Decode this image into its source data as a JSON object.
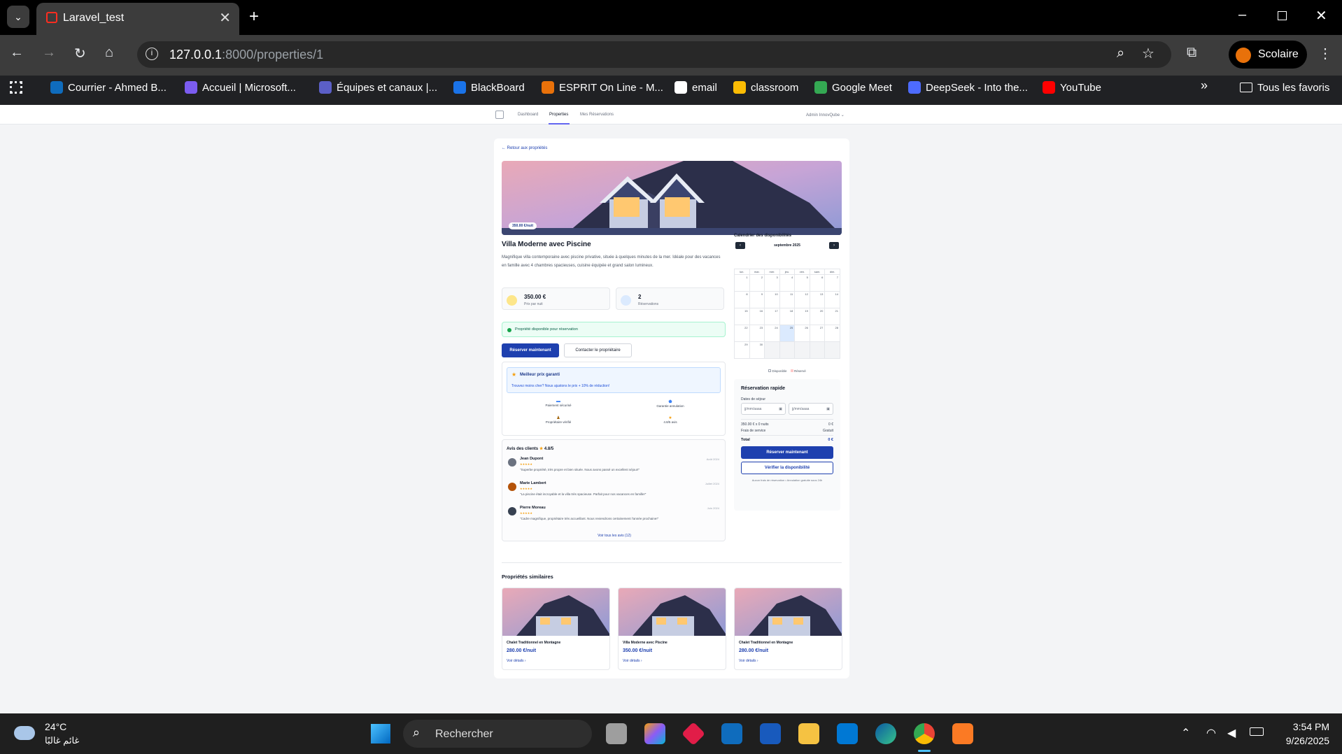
{
  "browser": {
    "tab_title": "Laravel_test",
    "url_host": "127.0.0.1",
    "url_rest": ":8000/properties/1",
    "profile": "Scolaire",
    "bookmarks": [
      {
        "label": "Courrier - Ahmed B...",
        "color": "#0f6cbd"
      },
      {
        "label": "Accueil | Microsoft...",
        "color": "#7b5cf0"
      },
      {
        "label": "Équipes et canaux |...",
        "color": "#5b5fc7"
      },
      {
        "label": "BlackBoard",
        "color": "#1a73e8"
      },
      {
        "label": "ESPRIT On Line - M...",
        "color": "#e8710a"
      },
      {
        "label": "email",
        "color": "#ffffff"
      },
      {
        "label": "classroom",
        "color": "#fbbc04"
      },
      {
        "label": "Google Meet",
        "color": "#34a853"
      },
      {
        "label": "DeepSeek - Into the...",
        "color": "#4d6bfe"
      },
      {
        "label": "YouTube",
        "color": "#ff0000"
      }
    ],
    "all_favorites": "Tous les favoris"
  },
  "nav": {
    "items": [
      "Dashboard",
      "Properties",
      "Mes Réservations"
    ],
    "user": "Admin InnovQube"
  },
  "property": {
    "back_link": "Retour aux propriétés",
    "price_badge": "350.00 €/nuit",
    "title": "Villa Moderne avec Piscine",
    "description": "Magnifique villa contemporaine avec piscine privative, située à quelques minutes de la mer. Idéale pour des vacances en famille avec 4 chambres spacieuses, cuisine équipée et grand salon lumineux.",
    "price_value": "350.00 €",
    "price_label": "Prix par nuit",
    "reservations_value": "2",
    "reservations_label": "Réservations",
    "availability": "Propriété disponible pour réservation",
    "btn_reserve": "Réserver maintenant",
    "btn_contact": "Contacter le propriétaire",
    "promo_title": "Meilleur prix garanti",
    "promo_text": "Trouvez moins cher? Nous ajustons le prix + 10% de réduction!",
    "features": [
      "Paiement sécurisé",
      "Garantie annulation",
      "Propriétaire vérifié",
      "4.8/5 avis"
    ]
  },
  "reviews": {
    "title": "Avis des clients",
    "rating": "4.8/5",
    "items": [
      {
        "name": "Jean Dupont",
        "date": "Août 2024",
        "stars": "★★★★★",
        "text": "\"Superbe propriété, très propre et bien située. Nous avons passé un excellent séjour!\""
      },
      {
        "name": "Marie Lambert",
        "date": "Juillet 2024",
        "stars": "★★★★★",
        "text": "\"La piscine était incroyable et la villa très spacieuse. Parfait pour nos vacances en famille!\""
      },
      {
        "name": "Pierre Moreau",
        "date": "Juin 2024",
        "stars": "★★★★★",
        "text": "\"Cadre magnifique, propriétaire très accueillant. Nous reviendrons certainement l'année prochaine!\""
      }
    ],
    "see_all": "Voir tous les avis (12)"
  },
  "calendar": {
    "title": "Calendrier des disponibilités",
    "month": "septembre 2025",
    "weekdays": [
      "lun.",
      "mar.",
      "mer.",
      "jeu.",
      "ven.",
      "sam.",
      "dim."
    ],
    "legend_available": "Disponible",
    "legend_reserved": "Réservé"
  },
  "quick": {
    "title": "Réservation rapide",
    "dates_label": "Dates de séjour",
    "date_placeholder": "jj/mm/aaaa",
    "line1_label": "350.00 € x 0 nuits",
    "line1_value": "0 €",
    "line2_label": "Frais de service",
    "line2_value": "Gratuit",
    "total_label": "Total",
    "total_value": "0 €",
    "btn_reserve": "Réserver maintenant",
    "btn_check": "Vérifier la disponibilité",
    "note": "Aucun frais de réservation • Annulation gratuite sous 24h"
  },
  "similar": {
    "title": "Propriétés similaires",
    "link": "Voir détails",
    "items": [
      {
        "name": "Chalet Traditionnel en Montagne",
        "price": "280.00 €/nuit"
      },
      {
        "name": "Villa Moderne avec Piscine",
        "price": "350.00 €/nuit"
      },
      {
        "name": "Chalet Traditionnel en Montagne",
        "price": "280.00 €/nuit"
      }
    ]
  },
  "taskbar": {
    "temp": "24°C",
    "weather": "غائم غالبًا",
    "search": "Rechercher",
    "time": "3:54 PM",
    "date": "9/26/2025"
  }
}
